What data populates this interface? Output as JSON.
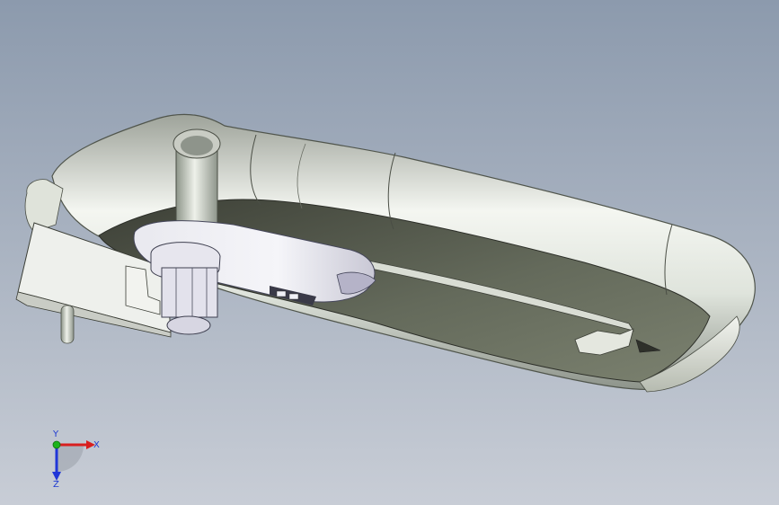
{
  "viewport": {
    "background_top": "#8a99ad",
    "background_bottom": "#c6cbd3"
  },
  "model": {
    "outer_color": "#e8ece6",
    "inner_shadow_color": "#5b5f52",
    "part_color": "#e3e3ea"
  },
  "triad": {
    "x_label": "X",
    "y_label": "Y",
    "z_label": "Z",
    "x_color": "#d81f1f",
    "y_color": "#1bb31b",
    "z_color": "#2036d8"
  }
}
